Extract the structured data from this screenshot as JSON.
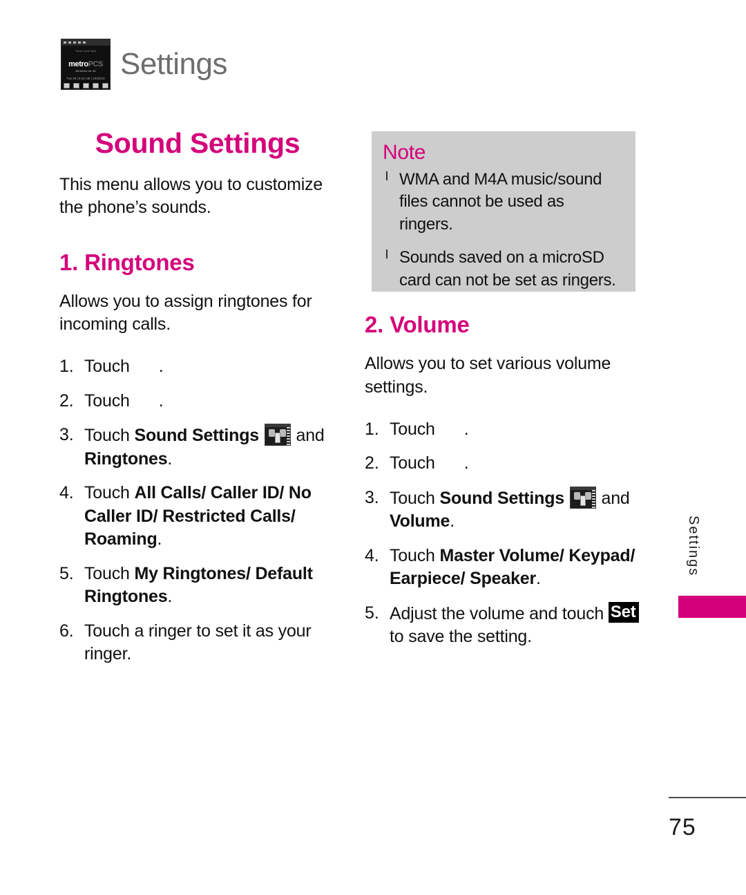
{
  "header": {
    "title": "Settings",
    "thumbnail": {
      "icon": "phone-screenshot-thumbnail",
      "caption": "Touch and hold",
      "logo_primary": "metro",
      "logo_secondary": "PCS",
      "logo_tagline": "Wireless for all",
      "status_line": "Tue 20 | 9:41 AM | 10/20/10"
    }
  },
  "colors": {
    "accent_pink": "#d4007a",
    "note_background": "#cdcdcd",
    "header_gray": "#6e6e6e",
    "text_black": "#111111"
  },
  "left_column": {
    "section_title": "Sound Settings",
    "intro": "This menu allows you to customize the phone’s sounds.",
    "subsection_title": "1. Ringtones",
    "subsection_intro": "Allows you to assign ringtones for incoming calls.",
    "steps": [
      {
        "num": "1.",
        "pre": "Touch",
        "icon": "missing-menu-icon",
        "post": "."
      },
      {
        "num": "2.",
        "pre": "Touch",
        "icon": "missing-menu-icon",
        "post": "."
      },
      {
        "num": "3.",
        "pre": "Touch",
        "bold1": "Sound Settings",
        "icon": "sound-settings-screenshot-icon",
        "mid": "and",
        "bold2": "Ringtones",
        "post": "."
      },
      {
        "num": "4.",
        "pre": "Touch",
        "bold1": "All Calls/ Caller ID/ No Caller ID/ Restricted Calls/ Roaming",
        "post": "."
      },
      {
        "num": "5.",
        "pre": "Touch",
        "bold1": "My Ringtones/ Default Ringtones",
        "post": "."
      },
      {
        "num": "6.",
        "pre": "Touch a ringer to set it as your ringer.",
        "post": ""
      }
    ]
  },
  "note": {
    "title": "Note",
    "items": [
      "WMA and M4A music/sound files cannot be used as ringers.",
      "Sounds saved on a microSD card can not be set as ringers."
    ]
  },
  "right_column": {
    "subsection_title": "2. Volume",
    "subsection_intro": "Allows you to set various volume settings.",
    "steps": [
      {
        "num": "1.",
        "pre": "Touch",
        "icon": "missing-menu-icon",
        "post": "."
      },
      {
        "num": "2.",
        "pre": "Touch",
        "icon": "missing-menu-icon",
        "post": "."
      },
      {
        "num": "3.",
        "pre": "Touch",
        "bold1": "Sound Settings",
        "icon": "sound-settings-screenshot-icon",
        "mid": "and",
        "bold2": "Volume",
        "post": "."
      },
      {
        "num": "4.",
        "pre": "Touch",
        "bold1": "Master Volume/ Keypad/ Earpiece/ Speaker",
        "post": "."
      },
      {
        "num": "5.",
        "pre": "Adjust the volume and touch",
        "badge": "Set",
        "post": "to save the setting."
      }
    ]
  },
  "side_tab": {
    "label": "Settings"
  },
  "footer": {
    "page_number": "75"
  }
}
